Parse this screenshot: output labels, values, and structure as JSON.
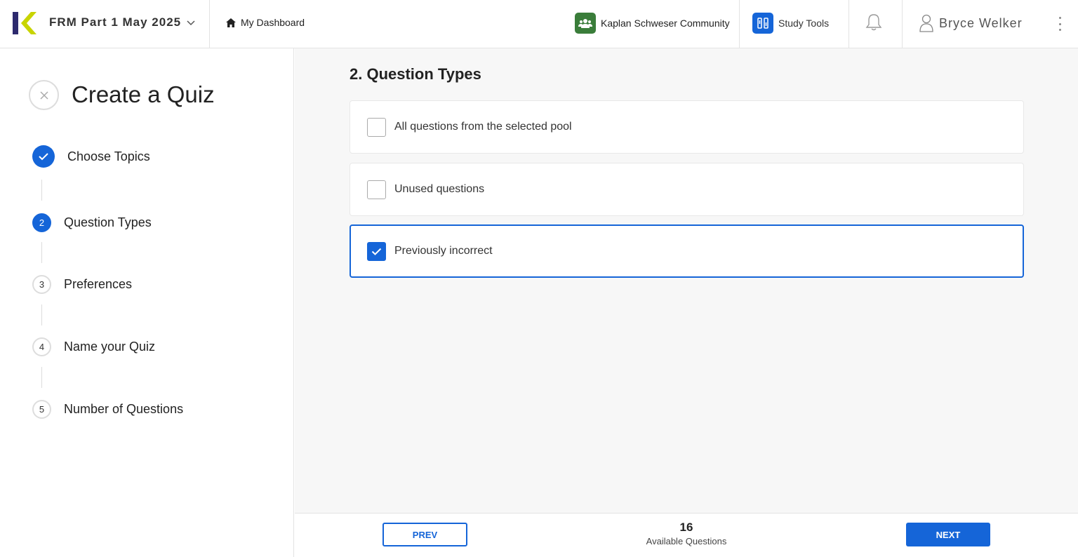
{
  "header": {
    "course": "FRM Part 1 May 2025",
    "dashboard": "My Dashboard",
    "community": "Kaplan Schweser Community",
    "study_tools": "Study Tools",
    "user_name": "Bryce Welker"
  },
  "sidebar": {
    "title": "Create a Quiz",
    "steps": [
      {
        "num": "",
        "label": "Choose Topics",
        "state": "done"
      },
      {
        "num": "2",
        "label": "Question Types",
        "state": "active"
      },
      {
        "num": "3",
        "label": "Preferences",
        "state": "todo"
      },
      {
        "num": "4",
        "label": "Name your Quiz",
        "state": "todo"
      },
      {
        "num": "5",
        "label": "Number of Questions",
        "state": "todo"
      }
    ]
  },
  "main": {
    "title": "2. Question Types",
    "options": [
      {
        "label": "All questions from the selected pool",
        "checked": false
      },
      {
        "label": "Unused questions",
        "checked": false
      },
      {
        "label": "Previously incorrect",
        "checked": true
      }
    ]
  },
  "footer": {
    "prev": "PREV",
    "next": "NEXT",
    "available_count": "16",
    "available_label": "Available Questions"
  },
  "colors": {
    "accent": "#1565d8",
    "community_badge": "#3a7d3a",
    "logo_navy": "#2d2a6e",
    "logo_lime": "#c8d400"
  }
}
